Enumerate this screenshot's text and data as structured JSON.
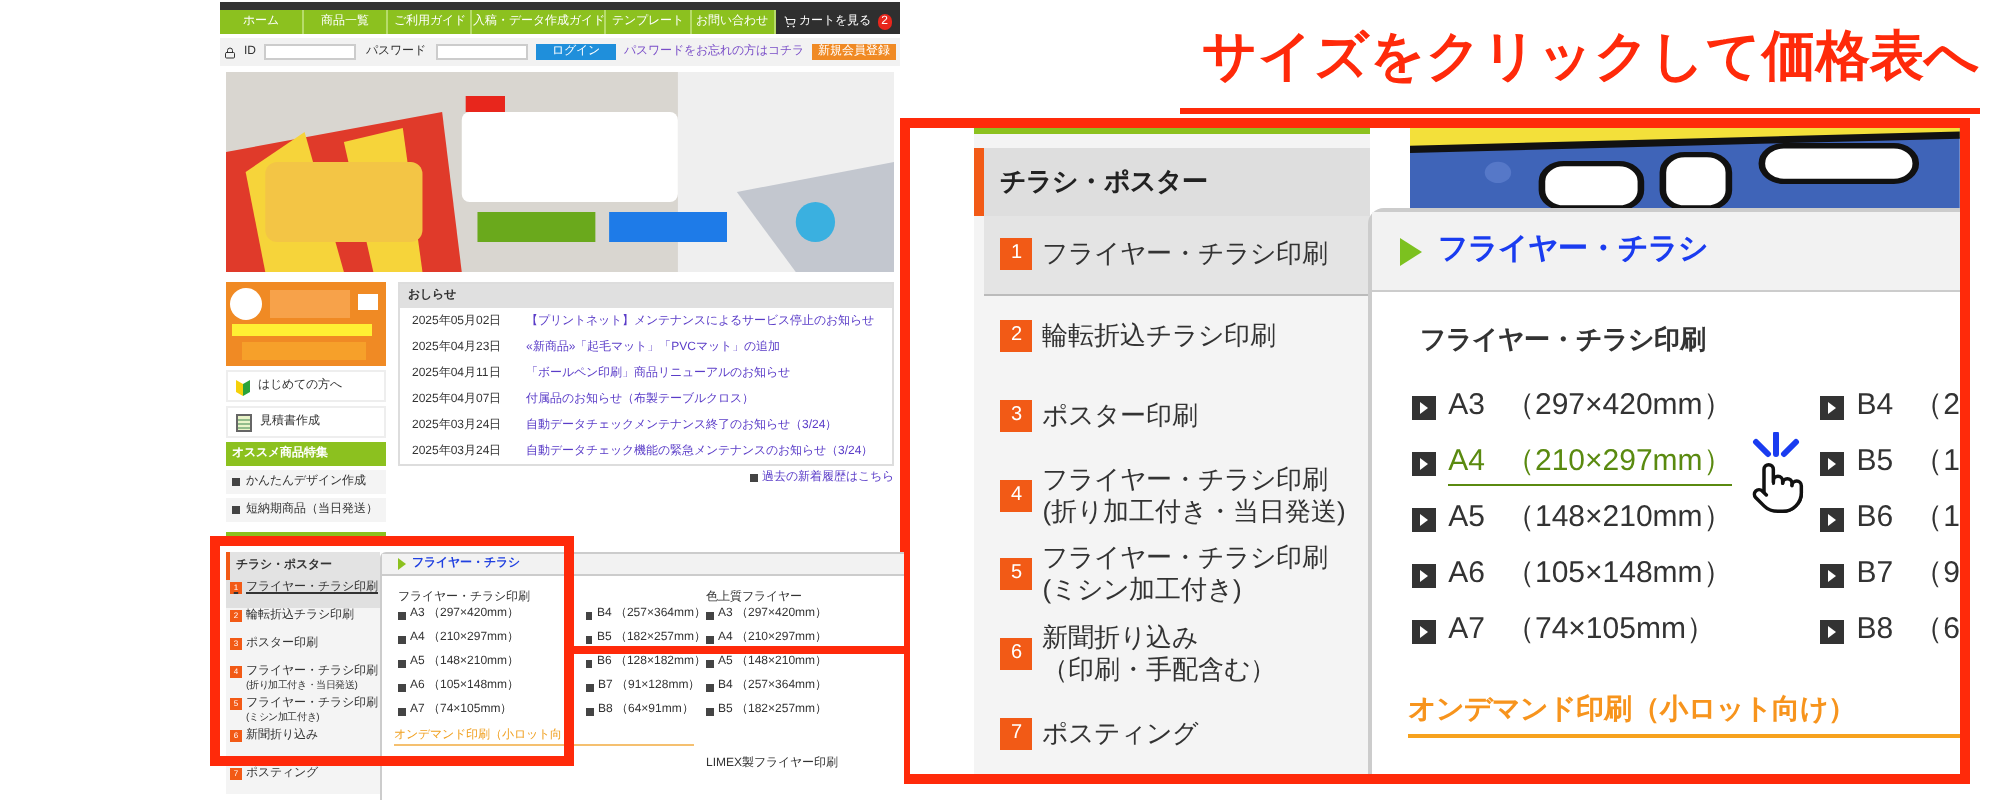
{
  "annotation": {
    "title": "サイズをクリックして価格表へ"
  },
  "site": {
    "nav": [
      {
        "label": "ホーム"
      },
      {
        "label": "商品一覧"
      },
      {
        "label": "ご利用ガイド"
      },
      {
        "label": "入稿・データ作成ガイド"
      },
      {
        "label": "テンプレート"
      },
      {
        "label": "お問い合わせ"
      }
    ],
    "cart": {
      "label": "カートを見る",
      "count": "2"
    },
    "login": {
      "id_label": "ID",
      "password_label": "パスワード",
      "button": "ログイン",
      "forgot_link": "パスワードをお忘れの方はコチラ",
      "register": "新規会員登録"
    },
    "sidebar": {
      "links": [
        "はじめての方へ",
        "見積書作成"
      ],
      "feature_heading": "オススメ商品特集",
      "features": [
        "かんたんデザイン作成",
        "短納期商品（当日発送）"
      ]
    },
    "news": {
      "heading": "おしらせ",
      "items": [
        {
          "date": "2025年05月02日",
          "title": "【プリントネット】メンテナンスによるサービス停止のお知らせ"
        },
        {
          "date": "2025年04月23日",
          "title": "«新商品»「起毛マット」「PVCマット」の追加"
        },
        {
          "date": "2025年04月11日",
          "title": "「ボールペン印刷」商品リニューアルのお知らせ"
        },
        {
          "date": "2025年04月07日",
          "title": "付属品のお知らせ（布製テーブルクロス）"
        },
        {
          "date": "2025年03月24日",
          "title": "自動データチェックメンテナンス終了のお知らせ（3/24）"
        },
        {
          "date": "2025年03月24日",
          "title": "自動データチェック機能の緊急メンテナンスのお知らせ（3/24）"
        }
      ],
      "more_link": "過去の新着履歴はこちら"
    },
    "menu": {
      "category": "チラシ・ポスター",
      "items": [
        {
          "number": "1",
          "label": "フライヤー・チラシ印刷",
          "selected": true
        },
        {
          "number": "2",
          "label": "輪転折込チラシ印刷",
          "selected": false
        },
        {
          "number": "3",
          "label": "ポスター印刷",
          "selected": false
        },
        {
          "number": "4",
          "label": "フライヤー・チラシ印刷",
          "sublabel": "(折り加工付き・当日発送)",
          "selected": false
        },
        {
          "number": "5",
          "label": "フライヤー・チラシ印刷",
          "sublabel": "(ミシン加工付き)",
          "selected": false
        },
        {
          "number": "6",
          "label": "新聞折り込み",
          "selected": false
        },
        {
          "number": "7",
          "label": "ポスティング",
          "selected": false
        }
      ]
    },
    "panel": {
      "title": "フライヤー・チラシ",
      "groups": [
        {
          "heading": "フライヤー・チラシ印刷",
          "columns": [
            [
              "A3 （297×420mm）",
              "A4 （210×297mm）",
              "A5 （148×210mm）",
              "A6 （105×148mm）",
              "A7 （74×105mm）"
            ],
            [
              "B4 （257×364mm）",
              "B5 （182×257mm）",
              "B6 （128×182mm）",
              "B7 （91×128mm）",
              "B8 （64×91mm）"
            ]
          ]
        },
        {
          "heading": "色上質フライヤー",
          "columns": [
            [
              "A3 （297×420mm）",
              "A4 （210×297mm）",
              "A5 （148×210mm）",
              "B4 （257×364mm）",
              "B5 （182×257mm）"
            ]
          ]
        }
      ],
      "ondemand": "オンデマンド印刷（小ロット向",
      "ondemand_item": "LIMEX製フライヤー印刷"
    }
  },
  "callout": {
    "menu": {
      "category": "チラシ・ポスター",
      "items": [
        {
          "number": "1",
          "label": "フライヤー・チラシ印刷",
          "selected": true
        },
        {
          "number": "2",
          "label": "輪転折込チラシ印刷",
          "selected": false
        },
        {
          "number": "3",
          "label": "ポスター印刷",
          "selected": false
        },
        {
          "number": "4",
          "label": "フライヤー・チラシ印刷",
          "sublabel": "(折り加工付き・当日発送)",
          "selected": false
        },
        {
          "number": "5",
          "label": "フライヤー・チラシ印刷",
          "sublabel": "(ミシン加工付き)",
          "selected": false
        },
        {
          "number": "6",
          "label": "新聞折り込み",
          "sublabel": "（印刷・手配含む）",
          "selected": false
        },
        {
          "number": "7",
          "label": "ポスティング",
          "selected": false
        }
      ]
    },
    "panel": {
      "title": "フライヤー・チラシ",
      "section": "フライヤー・チラシ印刷",
      "a_sizes": [
        {
          "size": "A3",
          "dims": "（297×420mm）",
          "selected": false
        },
        {
          "size": "A4",
          "dims": "（210×297mm）",
          "selected": true
        },
        {
          "size": "A5",
          "dims": "（148×210mm）",
          "selected": false
        },
        {
          "size": "A6",
          "dims": "（105×148mm）",
          "selected": false
        },
        {
          "size": "A7",
          "dims": "（74×105mm）",
          "selected": false
        }
      ],
      "b_sizes": [
        {
          "size": "B4",
          "dims": "（2",
          "selected": false
        },
        {
          "size": "B5",
          "dims": "（1",
          "selected": false
        },
        {
          "size": "B6",
          "dims": "（1",
          "selected": false
        },
        {
          "size": "B7",
          "dims": "（9",
          "selected": false
        },
        {
          "size": "B8",
          "dims": "（6",
          "selected": false
        }
      ],
      "ondemand": "オンデマンド印刷（小ロット向け）"
    }
  }
}
